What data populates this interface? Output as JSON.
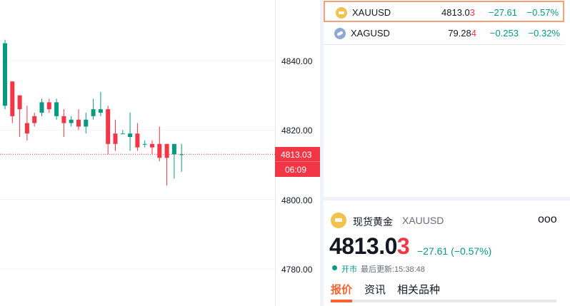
{
  "chart": {
    "price_axis": [
      "4840.00",
      "4820.00",
      "4800.00",
      "4780.00"
    ],
    "current_price": "4813.03",
    "countdown": "06:09",
    "colors": {
      "up": "#089981",
      "down": "#f23645"
    },
    "candles": [
      {
        "o": 4827,
        "h": 4846,
        "l": 4826,
        "c": 4845
      },
      {
        "o": 4834,
        "h": 4834,
        "l": 4822,
        "c": 4824
      },
      {
        "o": 4830,
        "h": 4830,
        "l": 4818,
        "c": 4826
      },
      {
        "o": 4822,
        "h": 4827,
        "l": 4817,
        "c": 4819
      },
      {
        "o": 4824,
        "h": 4825,
        "l": 4821,
        "c": 4822
      },
      {
        "o": 4825,
        "h": 4829,
        "l": 4824,
        "c": 4828
      },
      {
        "o": 4828,
        "h": 4829,
        "l": 4825,
        "c": 4826
      },
      {
        "o": 4824,
        "h": 4829,
        "l": 4823,
        "c": 4828
      },
      {
        "o": 4824,
        "h": 4826,
        "l": 4818,
        "c": 4822
      },
      {
        "o": 4822,
        "h": 4824,
        "l": 4821,
        "c": 4823
      },
      {
        "o": 4823,
        "h": 4826,
        "l": 4820,
        "c": 4821
      },
      {
        "o": 4821,
        "h": 4825,
        "l": 4819,
        "c": 4823
      },
      {
        "o": 4824,
        "h": 4829,
        "l": 4823,
        "c": 4826
      },
      {
        "o": 4825,
        "h": 4831,
        "l": 4824,
        "c": 4826
      },
      {
        "o": 4826,
        "h": 4827,
        "l": 4813,
        "c": 4816
      },
      {
        "o": 4819,
        "h": 4823,
        "l": 4814,
        "c": 4816
      },
      {
        "o": 4819,
        "h": 4820,
        "l": 4819,
        "c": 4819
      },
      {
        "o": 4818,
        "h": 4825,
        "l": 4814,
        "c": 4819
      },
      {
        "o": 4819,
        "h": 4822,
        "l": 4814,
        "c": 4815
      },
      {
        "o": 4816,
        "h": 4817,
        "l": 4815,
        "c": 4816
      },
      {
        "o": 4816,
        "h": 4817,
        "l": 4813,
        "c": 4815
      },
      {
        "o": 4816,
        "h": 4821,
        "l": 4811,
        "c": 4812
      },
      {
        "o": 4816,
        "h": 4816,
        "l": 4804,
        "c": 4812
      },
      {
        "o": 4813,
        "h": 4816,
        "l": 4806,
        "c": 4816
      },
      {
        "o": 4813,
        "h": 4816,
        "l": 4808,
        "c": 4813
      }
    ]
  },
  "watchlist": [
    {
      "symbol": "XAUUSD",
      "last_main": "4813.0",
      "last_hl": "3",
      "change": "−27.61",
      "change_pct": "−0.57%",
      "icon_color": "#f2c14e"
    },
    {
      "symbol": "XAGUSD",
      "last_main": "79.28",
      "last_hl": "4",
      "change": "−0.253",
      "change_pct": "−0.32%",
      "icon_color": "#8fa9d6"
    }
  ],
  "detail": {
    "name": "现货黄金",
    "symbol": "XAUUSD",
    "more": "ooo",
    "price_main": "4813.0",
    "price_hl": "3",
    "change": "−27.61 (−0.57%)",
    "status": "开市",
    "updated": "最后更新:15:38:48",
    "tabs": [
      "报价",
      "资讯",
      "相关品种"
    ]
  }
}
